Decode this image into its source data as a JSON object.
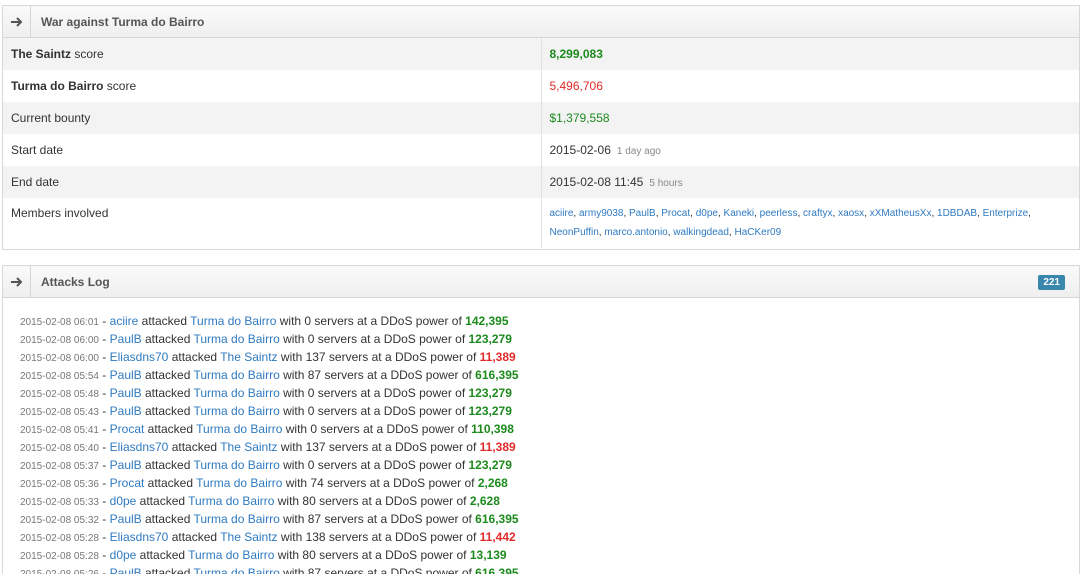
{
  "war": {
    "title": "War against Turma do Bairro",
    "rows": {
      "team1": {
        "name": "The Saintz",
        "suffix": " score",
        "value": "8,299,083"
      },
      "team2": {
        "name": "Turma do Bairro",
        "suffix": " score",
        "value": "5,496,706"
      },
      "bounty": {
        "label": "Current bounty",
        "value": "$1,379,558"
      },
      "start": {
        "label": "Start date",
        "value": "2015-02-06",
        "note": "1 day ago"
      },
      "end": {
        "label": "End date",
        "value": "2015-02-08 11:45",
        "note": "5 hours"
      },
      "members": {
        "label": "Members involved"
      }
    },
    "members": [
      "aciire",
      "army9038",
      "PaulB",
      "Procat",
      "d0pe",
      "Kaneki",
      "peerless",
      "craftyx",
      "xaosx",
      "xXMatheusXx",
      "1DBDAB",
      "Enterprize",
      "NeonPuffin",
      "marco.antonio",
      "walkingdead",
      "HaCKer09"
    ]
  },
  "log": {
    "title": "Attacks Log",
    "count": "221",
    "entries": [
      {
        "ts": "2015-02-08 06:01",
        "attacker": "aciire",
        "target": "Turma do Bairro",
        "servers": "0",
        "power": "142,395",
        "color": "green"
      },
      {
        "ts": "2015-02-08 06:00",
        "attacker": "PaulB",
        "target": "Turma do Bairro",
        "servers": "0",
        "power": "123,279",
        "color": "green"
      },
      {
        "ts": "2015-02-08 06:00",
        "attacker": "Eliasdns70",
        "target": "The Saintz",
        "servers": "137",
        "power": "11,389",
        "color": "red"
      },
      {
        "ts": "2015-02-08 05:54",
        "attacker": "PaulB",
        "target": "Turma do Bairro",
        "servers": "87",
        "power": "616,395",
        "color": "green"
      },
      {
        "ts": "2015-02-08 05:48",
        "attacker": "PaulB",
        "target": "Turma do Bairro",
        "servers": "0",
        "power": "123,279",
        "color": "green"
      },
      {
        "ts": "2015-02-08 05:43",
        "attacker": "PaulB",
        "target": "Turma do Bairro",
        "servers": "0",
        "power": "123,279",
        "color": "green"
      },
      {
        "ts": "2015-02-08 05:41",
        "attacker": "Procat",
        "target": "Turma do Bairro",
        "servers": "0",
        "power": "110,398",
        "color": "green"
      },
      {
        "ts": "2015-02-08 05:40",
        "attacker": "Eliasdns70",
        "target": "The Saintz",
        "servers": "137",
        "power": "11,389",
        "color": "red"
      },
      {
        "ts": "2015-02-08 05:37",
        "attacker": "PaulB",
        "target": "Turma do Bairro",
        "servers": "0",
        "power": "123,279",
        "color": "green"
      },
      {
        "ts": "2015-02-08 05:36",
        "attacker": "Procat",
        "target": "Turma do Bairro",
        "servers": "74",
        "power": "2,268",
        "color": "green"
      },
      {
        "ts": "2015-02-08 05:33",
        "attacker": "d0pe",
        "target": "Turma do Bairro",
        "servers": "80",
        "power": "2,628",
        "color": "green"
      },
      {
        "ts": "2015-02-08 05:32",
        "attacker": "PaulB",
        "target": "Turma do Bairro",
        "servers": "87",
        "power": "616,395",
        "color": "green"
      },
      {
        "ts": "2015-02-08 05:28",
        "attacker": "Eliasdns70",
        "target": "The Saintz",
        "servers": "138",
        "power": "11,442",
        "color": "red"
      },
      {
        "ts": "2015-02-08 05:28",
        "attacker": "d0pe",
        "target": "Turma do Bairro",
        "servers": "80",
        "power": "13,139",
        "color": "green"
      },
      {
        "ts": "2015-02-08 05:26",
        "attacker": "PaulB",
        "target": "Turma do Bairro",
        "servers": "87",
        "power": "616,395",
        "color": "green"
      }
    ],
    "phrases": {
      "attacked": " attacked ",
      "with": " with ",
      "servers": " servers at a DDoS power of "
    }
  },
  "icons": {
    "header_arrow": "arrow-right-icon"
  },
  "colors": {
    "green": "#1d8a1d",
    "red": "#e02a2a",
    "link": "#2f7ac0",
    "badge": "#3a87ad"
  }
}
